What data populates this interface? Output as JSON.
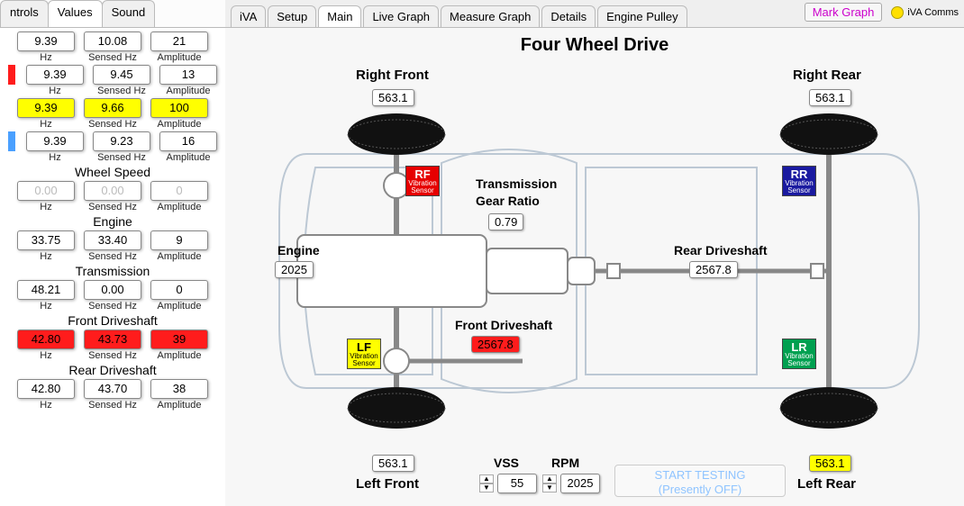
{
  "left_tabs": {
    "t0": "ntrols",
    "t1": "Values",
    "t2": "Sound",
    "active": 1
  },
  "main_tabs": {
    "t0": "iVA",
    "t1": "Setup",
    "t2": "Main",
    "t3": "Live Graph",
    "t4": "Measure Graph",
    "t5": "Details",
    "t6": "Engine Pulley",
    "active": 2
  },
  "mark_btn": "Mark Graph",
  "iva_comms": "iVA Comms",
  "cols": {
    "hz": "Hz",
    "sensed": "Sensed Hz",
    "amp": "Amplitude"
  },
  "sections": {
    "row1": {
      "hz": "9.39",
      "sensed": "10.08",
      "amp": "21",
      "hl": ""
    },
    "row2": {
      "hz": "9.39",
      "sensed": "9.45",
      "amp": "13",
      "hl": ""
    },
    "row3": {
      "hz": "9.39",
      "sensed": "9.66",
      "amp": "100",
      "hl": "yellow"
    },
    "row4": {
      "hz": "9.39",
      "sensed": "9.23",
      "amp": "16",
      "hl": ""
    },
    "wheel": {
      "title": "Wheel Speed",
      "hz": "0.00",
      "sensed": "0.00",
      "amp": "0"
    },
    "engine": {
      "title": "Engine",
      "hz": "33.75",
      "sensed": "33.40",
      "amp": "9"
    },
    "trans": {
      "title": "Transmission",
      "hz": "48.21",
      "sensed": "0.00",
      "amp": "0"
    },
    "fds": {
      "title": "Front Driveshaft",
      "hz": "42.80",
      "sensed": "43.73",
      "amp": "39",
      "hl": "red"
    },
    "rds": {
      "title": "Rear Driveshaft",
      "hz": "42.80",
      "sensed": "43.70",
      "amp": "38"
    }
  },
  "main": {
    "title": "Four Wheel Drive",
    "rf": {
      "lbl": "Right Front",
      "val": "563.1"
    },
    "rr": {
      "lbl": "Right Rear",
      "val": "563.1"
    },
    "lf": {
      "lbl": "Left Front",
      "val": "563.1"
    },
    "lr": {
      "lbl": "Left Rear",
      "val": "563.1",
      "hl": "yellow"
    },
    "engine_lbl": "Engine",
    "engine_val": "2025",
    "gear_lbl1": "Transmission",
    "gear_lbl2": "Gear Ratio",
    "gear_val": "0.79",
    "rds_lbl": "Rear Driveshaft",
    "rds_val": "2567.8",
    "fds_lbl": "Front Driveshaft",
    "fds_val": "2567.8",
    "vss_lbl": "VSS",
    "vss_val": "55",
    "rpm_lbl": "RPM",
    "rpm_val": "2025",
    "start_l1": "START TESTING",
    "start_l2": "(Presently OFF)",
    "sensor_rf": "RF",
    "sensor_rr": "RR",
    "sensor_lf": "LF",
    "sensor_lr": "LR",
    "sensor_sub": "Vibration Sensor"
  }
}
